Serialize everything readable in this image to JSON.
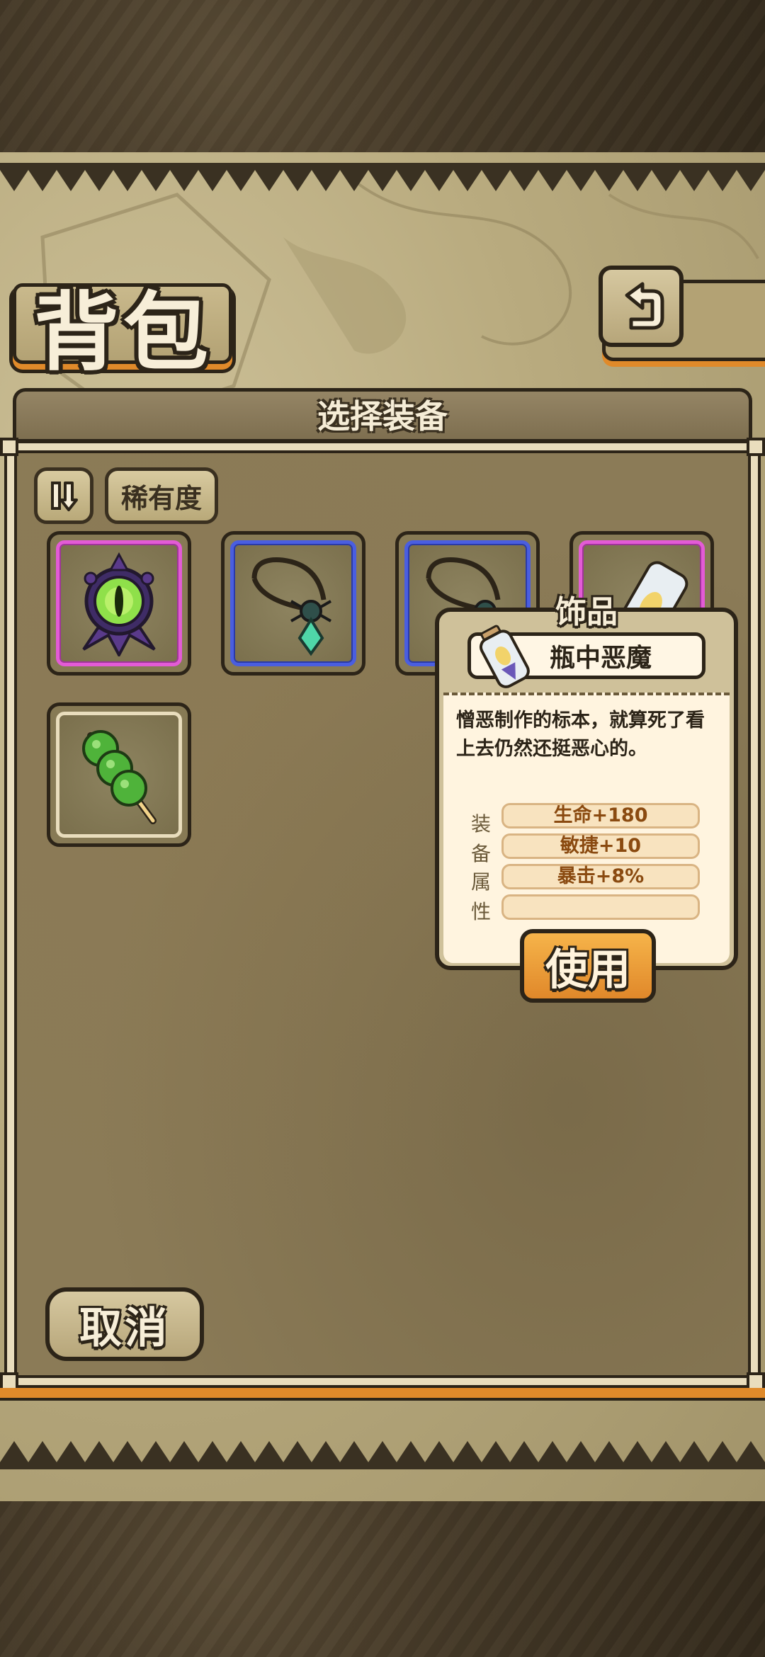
{
  "header": {
    "title": "背包",
    "back_icon": "back-arrow-icon"
  },
  "panel": {
    "title": "选择装备",
    "sort_icon": "sort-toggle-icon",
    "rarity_filter_label": "稀有度"
  },
  "items": [
    {
      "icon": "eye-amulet-icon",
      "rarity": "purple"
    },
    {
      "icon": "spider-necklace-icon",
      "rarity": "blue"
    },
    {
      "icon": "spider-necklace-icon",
      "rarity": "blue"
    },
    {
      "icon": "demon-bottle-icon",
      "rarity": "purple"
    },
    {
      "icon": "green-skewer-icon",
      "rarity": "plain"
    }
  ],
  "tooltip": {
    "type": "饰品",
    "name": "瓶中恶魔",
    "icon": "demon-bottle-icon",
    "description": "憎恶制作的标本，就算死了看上去仍然还挺恶心的。",
    "stats_label_chars": [
      "装",
      "备",
      "属",
      "性"
    ],
    "stats": [
      "生命+180",
      "敏捷+10",
      "暴击+8%",
      ""
    ],
    "use_label": "使用"
  },
  "footer": {
    "cancel_label": "取消"
  },
  "colors": {
    "purple_rarity": "#e35bd6",
    "blue_rarity": "#4a5ee0",
    "accent_orange": "#e08a2a",
    "ink": "#2c2418"
  }
}
